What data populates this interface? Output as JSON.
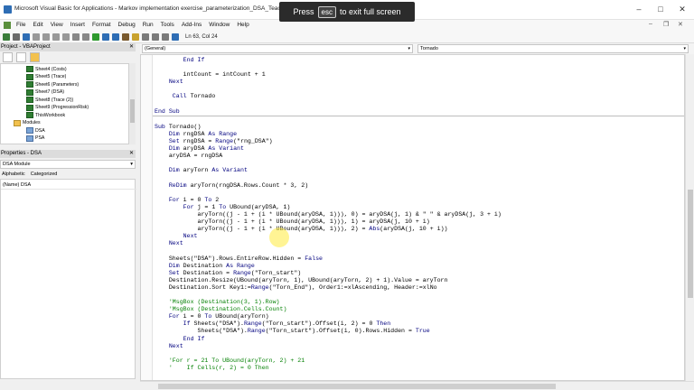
{
  "window": {
    "title": "Microsoft Visual Basic for Applications - Markov implementation exercise_parameterization_DSA_Teaching.xlsm",
    "controls": [
      "–",
      "□",
      "✕"
    ]
  },
  "overlay": {
    "pre": "Press",
    "key": "esc",
    "post": "to exit full screen"
  },
  "menu": {
    "items": [
      "File",
      "Edit",
      "View",
      "Insert",
      "Format",
      "Debug",
      "Run",
      "Tools",
      "Add-Ins",
      "Window",
      "Help"
    ],
    "mdi_controls": [
      "–",
      "❐",
      "✕"
    ]
  },
  "toolbar": {
    "position": "Ln 63, Col 24"
  },
  "project": {
    "title": "Project - VBAProject",
    "close": "✕",
    "tree": [
      {
        "label": "Sheet4 (Costs)",
        "kind": "sheet"
      },
      {
        "label": "Sheet5 (Trace)",
        "kind": "sheet"
      },
      {
        "label": "Sheet6 (Parameters)",
        "kind": "sheet"
      },
      {
        "label": "Sheet7 (DSA)",
        "kind": "sheet"
      },
      {
        "label": "Sheet8 (Trace (2))",
        "kind": "sheet"
      },
      {
        "label": "Sheet9 (ProgressionRisk)",
        "kind": "sheet"
      },
      {
        "label": "ThisWorkbook",
        "kind": "sheet"
      },
      {
        "label": "Modules",
        "kind": "folder"
      },
      {
        "label": "DSA",
        "kind": "module"
      },
      {
        "label": "PSA",
        "kind": "module"
      }
    ]
  },
  "properties": {
    "title": "Properties - DSA",
    "close": "✕",
    "object": "DSA Module",
    "tabs": [
      "Alphabetic",
      "Categorized"
    ],
    "rows": [
      "(Name) DSA"
    ]
  },
  "code": {
    "general": "(General)",
    "procedure": "Tornado",
    "lines": [
      "        End If",
      "",
      "        intCount = intCount + 1",
      "    Next",
      "",
      "     Call Tornado",
      "",
      "End Sub",
      "---",
      "Sub Tornado()",
      "    Dim rngDSA As Range",
      "    Set rngDSA = Range(\"rng_DSA\")",
      "    Dim aryDSA As Variant",
      "    aryDSA = rngDSA",
      "",
      "    Dim aryTorn As Variant",
      "",
      "    ReDim aryTorn(rngDSA.Rows.Count * 3, 2)",
      "",
      "    For i = 0 To 2",
      "        For j = 1 To UBound(aryDSA, 1)",
      "            aryTorn((j - 1 + (i * UBound(aryDSA, 1))), 0) = aryDSA(j, 1) & \" \" & aryDSA(j, 3 + i)",
      "            aryTorn((j - 1 + (i * UBound(aryDSA, 1))), 1) = aryDSA(j, 10 + i)",
      "            aryTorn((j - 1 + (i * UBound(aryDSA, 1))), 2) = Abs(aryDSA(j, 10 + i))",
      "        Next",
      "    Next",
      "",
      "    Sheets(\"DSA\").Rows.EntireRow.Hidden = False",
      "    Dim Destination As Range",
      "    Set Destination = Range(\"Torn_start\")",
      "    Destination.Resize(UBound(aryTorn, 1), UBound(aryTorn, 2) + 1).Value = aryTorn",
      "    Destination.Sort Key1:=Range(\"Torn_End\"), Order1:=xlAscending, Header:=xlNo",
      "",
      "    'MsgBox (Destination(3, 1).Row)",
      "    'MsgBox (Destination.Cells.Count)",
      "    For i = 0 To UBound(aryTorn)",
      "        If Sheets(\"DSA\").Range(\"Torn_start\").Offset(i, 2) = 0 Then",
      "            Sheets(\"DSA\").Range(\"Torn_start\").Offset(i, 0).Rows.Hidden = True",
      "        End If",
      "    Next",
      "",
      "    'For r = 21 To UBound(aryTorn, 2) + 21",
      "    '    If Cells(r, 2) = 0 Then"
    ]
  },
  "colors": {
    "keyword": "#00007f",
    "comment": "#007f00",
    "cursor_highlight": "#ffeb3c"
  },
  "icons": [
    "vba-app-icon",
    "excel-doc-icon",
    "save-icon",
    "run-icon",
    "project-explorer-icon"
  ]
}
